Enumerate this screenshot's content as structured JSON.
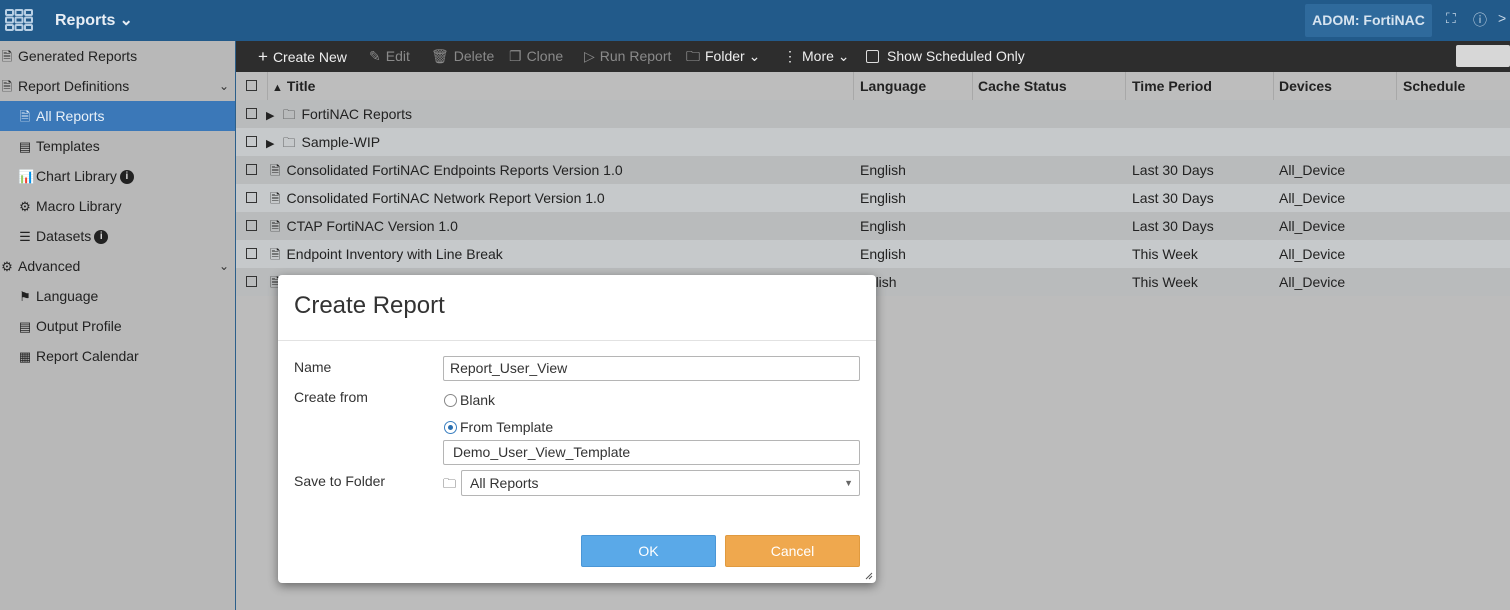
{
  "topbar": {
    "app_title": "Reports",
    "adom_label": "ADOM: FortiNAC",
    "icons": [
      "app-grid-icon",
      "expand-icon",
      "help-icon",
      "more-icon"
    ]
  },
  "sidebar": {
    "items": [
      {
        "label": "Generated Reports",
        "icon": "file-icon"
      },
      {
        "label": "Report Definitions",
        "icon": "file-icon"
      },
      {
        "label": "All Reports",
        "icon": "file-icon"
      },
      {
        "label": "Templates",
        "icon": "template-icon"
      },
      {
        "label": "Chart Library",
        "icon": "chart-icon"
      },
      {
        "label": "Macro Library",
        "icon": "gear-icon"
      },
      {
        "label": "Datasets",
        "icon": "dataset-icon"
      },
      {
        "label": "Advanced",
        "icon": "gear-icon"
      },
      {
        "label": "Language",
        "icon": "flag-icon"
      },
      {
        "label": "Output Profile",
        "icon": "output-icon"
      },
      {
        "label": "Report Calendar",
        "icon": "calendar-icon"
      }
    ]
  },
  "toolbar": {
    "create_new": "Create New",
    "edit": "Edit",
    "delete": "Delete",
    "clone": "Clone",
    "run_report": "Run Report",
    "folder": "Folder",
    "more": "More",
    "show_scheduled": "Show Scheduled Only"
  },
  "table": {
    "headers": {
      "title": "Title",
      "language": "Language",
      "cache_status": "Cache Status",
      "time_period": "Time Period",
      "devices": "Devices",
      "schedule": "Schedule"
    },
    "rows": [
      {
        "title": "FortiNAC Reports",
        "language": "",
        "time_period": "",
        "devices": ""
      },
      {
        "title": "Sample-WIP",
        "language": "",
        "time_period": "",
        "devices": ""
      },
      {
        "title": "Consolidated FortiNAC Endpoints Reports Version 1.0",
        "language": "English",
        "time_period": "Last 30 Days",
        "devices": "All_Device"
      },
      {
        "title": "Consolidated FortiNAC Network Report Version 1.0",
        "language": "English",
        "time_period": "Last 30 Days",
        "devices": "All_Device"
      },
      {
        "title": "CTAP FortiNAC Version 1.0",
        "language": "English",
        "time_period": "Last 30 Days",
        "devices": "All_Device"
      },
      {
        "title": "Endpoint Inventory with Line Break",
        "language": "English",
        "time_period": "This Week",
        "devices": "All_Device"
      },
      {
        "title": "",
        "language": "nglish",
        "time_period": "This Week",
        "devices": "All_Device"
      }
    ]
  },
  "dialog": {
    "title": "Create Report",
    "name_label": "Name",
    "name_value": "Report_User_View",
    "create_from_label": "Create from",
    "radio_blank": "Blank",
    "radio_template": "From Template",
    "template_value": "Demo_User_View_Template",
    "save_folder_label": "Save to Folder",
    "folder_value": "All Reports",
    "ok": "OK",
    "cancel": "Cancel"
  },
  "colors": {
    "topbar": "#225a8a",
    "active_nav": "#3b78b8",
    "ok_button": "#5aa9e8",
    "cancel_button": "#efa84e"
  }
}
